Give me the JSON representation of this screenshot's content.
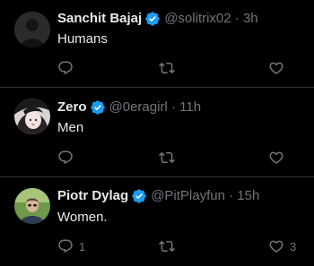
{
  "colors": {
    "background": "#000000",
    "text": "#e7e9ea",
    "muted": "#71767b",
    "verified": "#1d9bf0",
    "divider": "#2f3336"
  },
  "tweets": [
    {
      "name": "Sanchit Bajaj",
      "handle": "@solitrix02",
      "time": "3h",
      "text": "Humans",
      "reply_count": "",
      "retweet_count": "",
      "like_count": ""
    },
    {
      "name": "Zero",
      "handle": "@0eragirl",
      "time": "11h",
      "text": "Men",
      "reply_count": "",
      "retweet_count": "",
      "like_count": ""
    },
    {
      "name": "Piotr Dylag",
      "handle": "@PitPlayfun",
      "time": "15h",
      "text": "Women.",
      "reply_count": "1",
      "retweet_count": "",
      "like_count": "3"
    }
  ],
  "separator": " · "
}
